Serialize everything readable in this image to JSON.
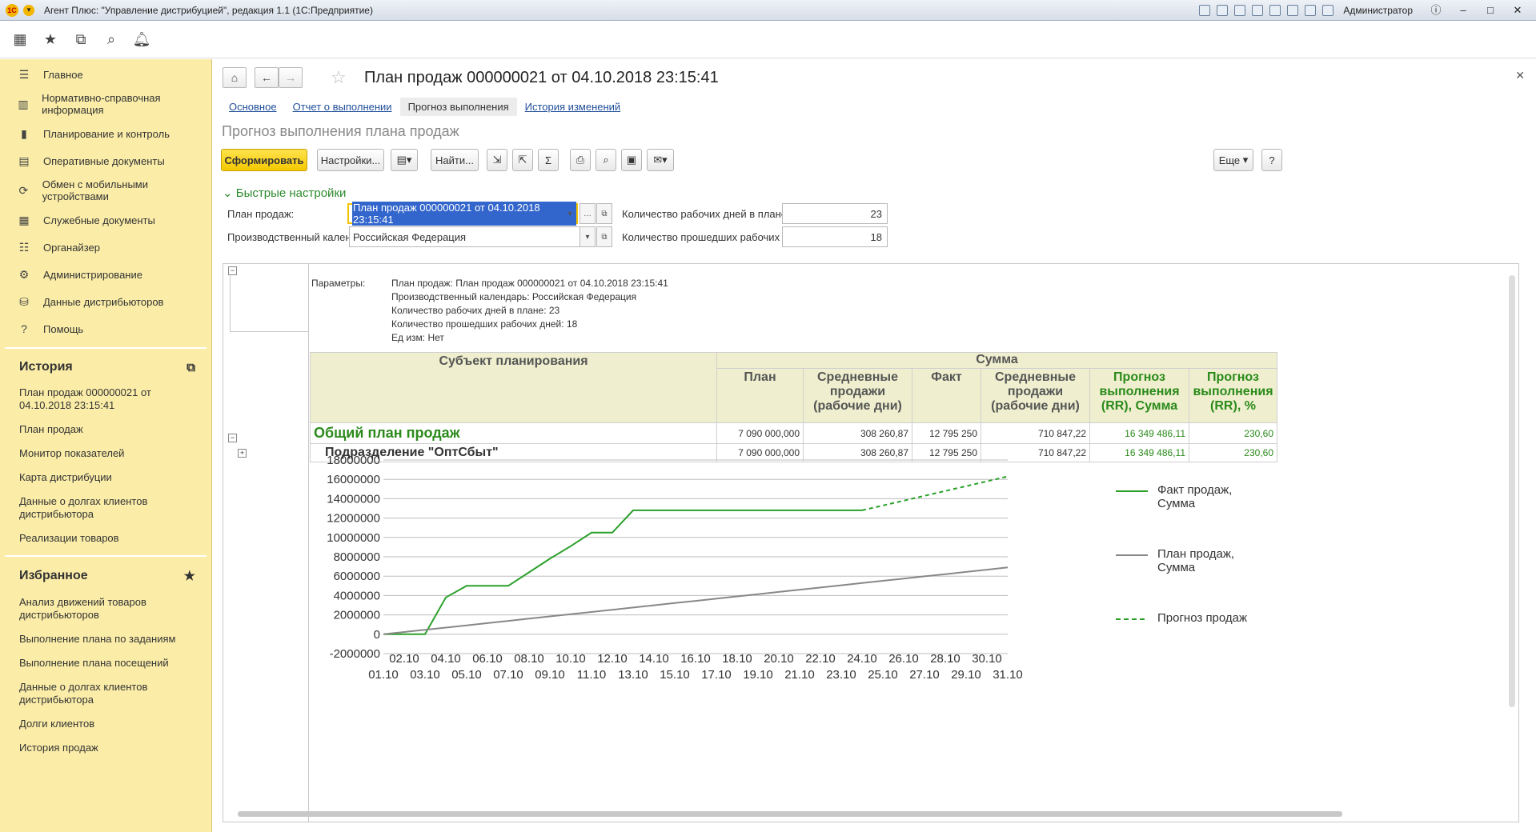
{
  "window": {
    "title": "Агент Плюс: \"Управление дистрибуцией\", редакция 1.1  (1С:Предприятие)",
    "user": "Администратор"
  },
  "sidebar": {
    "sections": [
      {
        "icon": "menu-icon",
        "label": "Главное"
      },
      {
        "icon": "book-icon",
        "label": "Нормативно-справочная информация"
      },
      {
        "icon": "chart-icon",
        "label": "Планирование и контроль"
      },
      {
        "icon": "doc-icon",
        "label": "Оперативные документы"
      },
      {
        "icon": "sync-icon",
        "label": "Обмен с мобильными устройствами"
      },
      {
        "icon": "list-icon",
        "label": "Служебные документы"
      },
      {
        "icon": "organizer-icon",
        "label": "Органайзер"
      },
      {
        "icon": "gear-icon",
        "label": "Администрирование"
      },
      {
        "icon": "distributor-icon",
        "label": "Данные дистрибьюторов"
      },
      {
        "icon": "help-icon",
        "label": "Помощь"
      }
    ],
    "history_title": "История",
    "history": [
      "План продаж 000000021 от 04.10.2018 23:15:41",
      "План продаж",
      "Монитор показателей",
      "Карта дистрибуции",
      "Данные о долгах клиентов дистрибьютора",
      "Реализации товаров"
    ],
    "favorites_title": "Избранное",
    "favorites": [
      "Анализ движений товаров дистрибьюторов",
      "Выполнение плана по заданиям",
      "Выполнение плана посещений",
      "Данные о долгах клиентов дистрибьютора",
      "Долги клиентов",
      "История продаж"
    ]
  },
  "doc": {
    "title": "План продаж 000000021 от 04.10.2018 23:15:41",
    "tabs": [
      "Основное",
      "Отчет о выполнении",
      "Прогноз выполнения",
      "История изменений"
    ],
    "form_title": "Прогноз выполнения плана продаж"
  },
  "toolbar": {
    "generate": "Сформировать",
    "settings": "Настройки...",
    "find": "Найти...",
    "more": "Еще",
    "help": "?"
  },
  "quick_settings": {
    "title": "Быстрые настройки",
    "plan_label": "План продаж:",
    "plan_value": "План продаж 000000021 от 04.10.2018 23:15:41",
    "calendar_label": "Производственный календарь:",
    "calendar_value": "Российская Федерация",
    "workdays_label": "Количество рабочих дней в плане:",
    "workdays_value": "23",
    "passed_label": "Количество прошедших рабочих дней:",
    "passed_value": "18"
  },
  "report": {
    "params_label": "Параметры:",
    "params": [
      "План продаж: План продаж 000000021 от 04.10.2018 23:15:41",
      "Производственный календарь: Российская Федерация",
      "Количество рабочих дней в плане: 23",
      "Количество прошедших рабочих дней: 18",
      "Ед изм: Нет"
    ],
    "headers": {
      "subject": "Субъект планирования",
      "sum": "Сумма",
      "plan": "План",
      "avg1": "Средневные продажи (рабочие дни)",
      "fact": "Факт",
      "avg2": "Средневные продажи (рабочие дни)",
      "rr_sum": "Прогноз выполнения (RR), Сумма",
      "rr_pct": "Прогноз выполнения (RR), %"
    },
    "rows": [
      {
        "name": "Общий план продаж",
        "plan": "7 090 000,000",
        "avg1": "308 260,87",
        "fact": "12 795 250",
        "avg2": "710 847,22",
        "rr_sum": "16 349 486,11",
        "rr_pct": "230,60"
      },
      {
        "name": "Подразделение \"ОптСбыт\"",
        "plan": "7 090 000,000",
        "avg1": "308 260,87",
        "fact": "12 795 250",
        "avg2": "710 847,22",
        "rr_sum": "16 349 486,11",
        "rr_pct": "230,60"
      }
    ]
  },
  "chart_data": {
    "type": "line",
    "x": [
      "01.10",
      "02.10",
      "03.10",
      "04.10",
      "05.10",
      "06.10",
      "07.10",
      "08.10",
      "09.10",
      "10.10",
      "11.10",
      "12.10",
      "13.10",
      "14.10",
      "15.10",
      "16.10",
      "17.10",
      "18.10",
      "19.10",
      "20.10",
      "21.10",
      "22.10",
      "23.10",
      "24.10",
      "25.10",
      "26.10",
      "27.10",
      "28.10",
      "29.10",
      "30.10",
      "31.10"
    ],
    "ylim": [
      -2000000,
      18000000
    ],
    "yticks": [
      "18000000",
      "16000000",
      "14000000",
      "12000000",
      "10000000",
      "8000000",
      "6000000",
      "4000000",
      "2000000",
      "0",
      "-2000000"
    ],
    "series": [
      {
        "name": "Факт продаж, Сумма",
        "color": "#2aa02a",
        "style": "solid",
        "values": [
          0,
          0,
          0,
          3800000,
          5000000,
          5000000,
          5000000,
          6400000,
          7800000,
          9100000,
          10500000,
          10500000,
          12800000,
          12800000,
          12800000,
          12800000,
          12800000,
          12800000,
          12800000,
          12800000,
          12800000,
          12800000,
          12800000,
          12800000
        ]
      },
      {
        "name": "План продаж, Сумма",
        "color": "#888888",
        "style": "solid",
        "values": [
          0,
          230000,
          460000,
          690000,
          920000,
          1150000,
          1380000,
          1610000,
          1840000,
          2070000,
          2300000,
          2530000,
          2760000,
          2990000,
          3220000,
          3450000,
          3680000,
          3910000,
          4140000,
          4370000,
          4600000,
          4830000,
          5060000,
          5290000,
          5520000,
          5750000,
          5980000,
          6210000,
          6440000,
          6670000,
          6900000
        ]
      },
      {
        "name": "Прогноз продаж",
        "color": "#2aa02a",
        "style": "dashed",
        "start": 23,
        "values": [
          12800000,
          13300000,
          13800000,
          14300000,
          14800000,
          15300000,
          15800000,
          16300000
        ]
      }
    ]
  }
}
